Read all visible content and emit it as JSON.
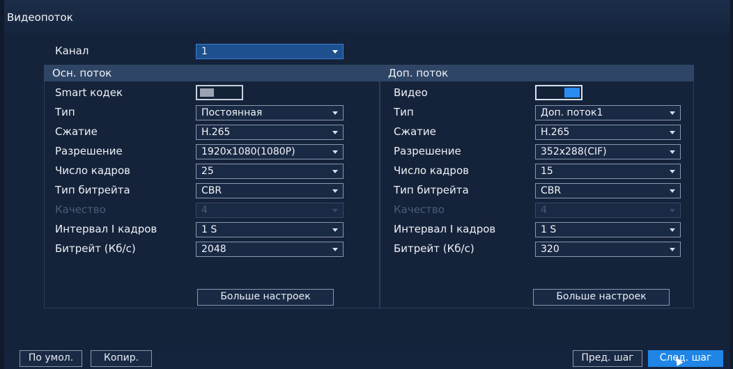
{
  "window": {
    "title": "Видеопоток"
  },
  "channel": {
    "label": "Канал",
    "value": "1"
  },
  "main_stream": {
    "header": "Осн. поток",
    "smart_codec_label": "Smart кодек",
    "smart_codec_state": "off",
    "rows": [
      {
        "label": "Тип",
        "value": "Постоянная",
        "enabled": true
      },
      {
        "label": "Сжатие",
        "value": "H.265",
        "enabled": true
      },
      {
        "label": "Разрешение",
        "value": "1920x1080(1080P)",
        "enabled": true
      },
      {
        "label": "Число кадров",
        "value": "25",
        "enabled": true
      },
      {
        "label": "Тип битрейта",
        "value": "CBR",
        "enabled": true
      },
      {
        "label": "Качество",
        "value": "4",
        "enabled": false
      },
      {
        "label": "Интервал I кадров",
        "value": "1 S",
        "enabled": true
      },
      {
        "label": "Битрейт (Кб/с)",
        "value": "2048",
        "enabled": true
      }
    ],
    "more_button": "Больше настроек"
  },
  "sub_stream": {
    "header": "Доп. поток",
    "video_label": "Видео",
    "video_state": "on",
    "rows": [
      {
        "label": "Тип",
        "value": "Доп. поток1",
        "enabled": true
      },
      {
        "label": "Сжатие",
        "value": "H.265",
        "enabled": true
      },
      {
        "label": "Разрешение",
        "value": "352x288(CIF)",
        "enabled": true
      },
      {
        "label": "Число кадров",
        "value": "15",
        "enabled": true
      },
      {
        "label": "Тип битрейта",
        "value": "CBR",
        "enabled": true
      },
      {
        "label": "Качество",
        "value": "4",
        "enabled": false
      },
      {
        "label": "Интервал I кадров",
        "value": "1 S",
        "enabled": true
      },
      {
        "label": "Битрейт (Кб/с)",
        "value": "320",
        "enabled": true
      }
    ],
    "more_button": "Больше настроек"
  },
  "footer": {
    "default_button": "По умол.",
    "copy_button": "Копир.",
    "prev_button": "Пред. шаг",
    "next_button": "След. шаг"
  },
  "colors": {
    "background": "#14223a",
    "panel_header": "#2f4566",
    "accent": "#1f86e8",
    "disabled_text": "#4c5c78"
  }
}
